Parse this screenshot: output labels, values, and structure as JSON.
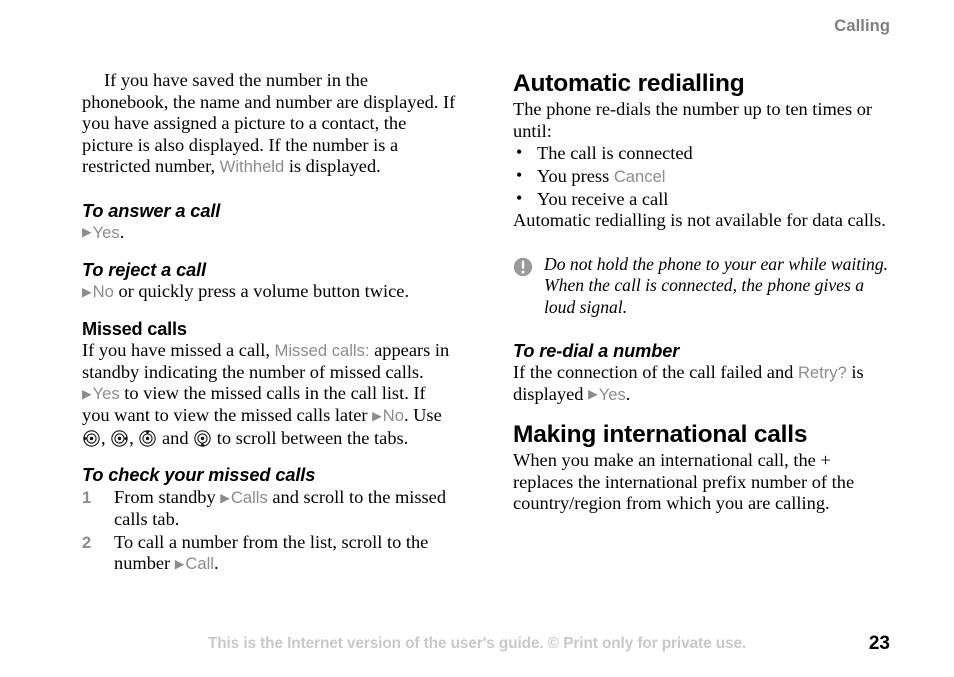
{
  "header": {
    "running_head": "Calling"
  },
  "left_column": {
    "intro_paragraph": {
      "before_ui": "If you have saved the number in the phonebook, the name and number are displayed. If you have assigned a picture to a contact, the picture is also displayed. If the number is a restricted number, ",
      "ui_term": "Withheld",
      "after_ui": " is displayed."
    },
    "answer_call": {
      "heading": "To answer a call",
      "arrow": "▶",
      "ui_term": "Yes",
      "after": "."
    },
    "reject_call": {
      "heading": "To reject a call",
      "arrow": "▶",
      "ui_term": "No",
      "after": " or quickly press a volume button twice."
    },
    "missed_calls": {
      "heading": "Missed calls",
      "para1_before": "If you have missed a call, ",
      "para1_ui": "Missed calls:",
      "para1_after": " appears in standby indicating the number of missed calls.",
      "para2_arrow1": "▶",
      "para2_ui1": "Yes",
      "para2_mid": " to view the missed calls in the call list. If you want to view the missed calls later ",
      "para2_arrow2": "▶",
      "para2_ui2": "No",
      "para2_after_no": ". Use ",
      "para2_comma1": ", ",
      "para2_comma2": ", ",
      "para2_and": " and ",
      "para2_tail": " to scroll between the tabs.",
      "nav_icons": [
        "nav-key-left-icon",
        "nav-key-right-icon",
        "nav-key-up-icon",
        "nav-key-down-icon"
      ]
    },
    "check_missed_calls": {
      "heading": "To check your missed calls",
      "steps": [
        {
          "num": "1",
          "before_ui": "From standby ",
          "arrow": "▶",
          "ui_term": "Calls",
          "after_ui": " and scroll to the missed calls tab."
        },
        {
          "num": "2",
          "before_ui": "To call a number from the list, scroll to the number ",
          "arrow": "▶",
          "ui_term": "Call",
          "after_ui": "."
        }
      ]
    }
  },
  "right_column": {
    "automatic_redialling": {
      "heading": "Automatic redialling",
      "intro": "The phone re-dials the number up to ten times or until:",
      "bullets": [
        {
          "bullet": "•",
          "before_ui": "The call is connected",
          "ui_term": "",
          "after_ui": ""
        },
        {
          "bullet": "•",
          "before_ui": "You press ",
          "ui_term": "Cancel",
          "after_ui": ""
        },
        {
          "bullet": "•",
          "before_ui": "You receive a call",
          "ui_term": "",
          "after_ui": ""
        }
      ],
      "outro": "Automatic redialling is not available for data calls."
    },
    "note": {
      "icon": "exclamation-circle-icon",
      "text": "Do not hold the phone to your ear while waiting. When the call is connected, the phone gives a loud signal."
    },
    "redial_number": {
      "heading": "To re-dial a number",
      "before_ui1": "If the connection of the call failed and ",
      "ui_term1": "Retry?",
      "mid": " is displayed ",
      "arrow": "▶",
      "ui_term2": "Yes",
      "after": "."
    },
    "international_calls": {
      "heading": "Making international calls",
      "paragraph": "When you make an international call, the + replaces the international prefix number of the country/region from which you are calling."
    }
  },
  "footer": {
    "disclaimer": "This is the Internet version of the user's guide. © Print only for private use.",
    "page_number": "23"
  },
  "colors": {
    "ui_term_gray": "#8c8c8c",
    "heading_black": "#000000",
    "running_head_gray": "#7f7f7f",
    "footer_gray": "#c9c9c9",
    "note_icon_gray": "#9a9a9a"
  }
}
